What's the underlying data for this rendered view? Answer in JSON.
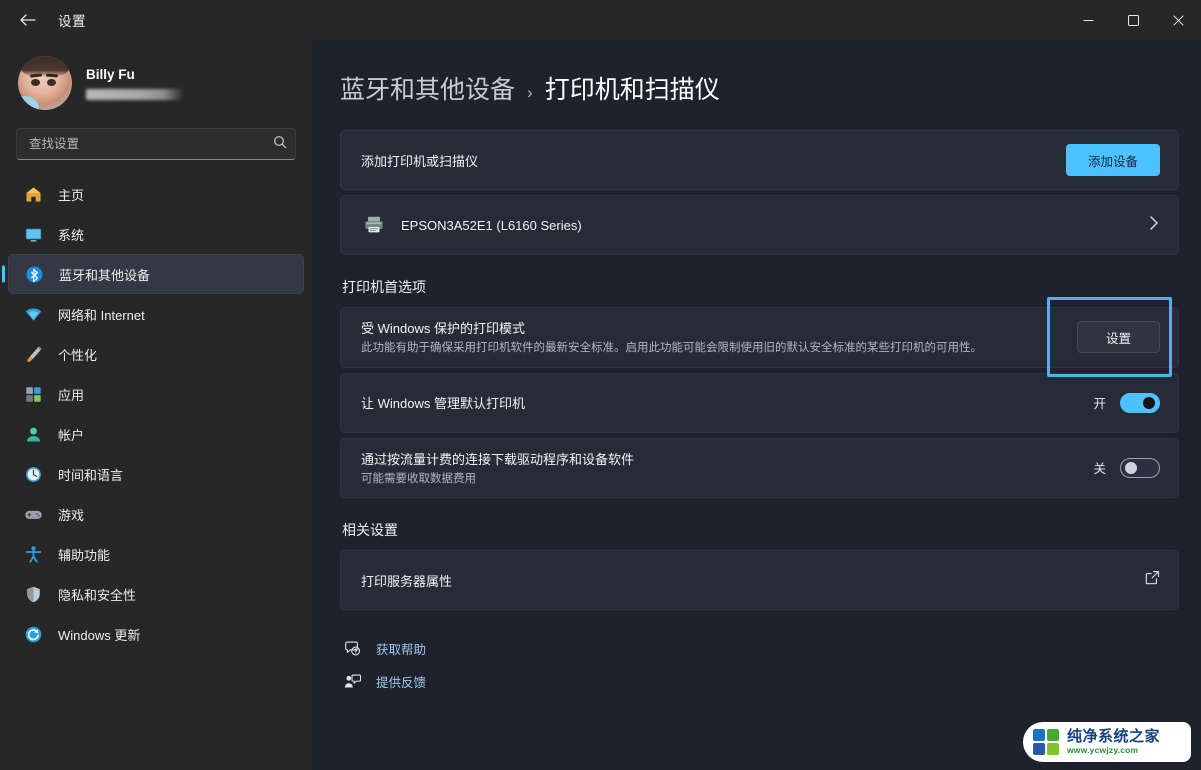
{
  "window": {
    "title": "设置",
    "back_label": "返回",
    "minimize_label": "最小化",
    "maximize_label": "最大化",
    "close_label": "关闭"
  },
  "profile": {
    "name": "Billy Fu",
    "email_redacted": ""
  },
  "search": {
    "placeholder": "查找设置",
    "value": ""
  },
  "sidebar": {
    "items": [
      {
        "label": "主页",
        "icon": "home-icon",
        "active": false
      },
      {
        "label": "系统",
        "icon": "system-icon",
        "active": false
      },
      {
        "label": "蓝牙和其他设备",
        "icon": "bluetooth-icon",
        "active": true
      },
      {
        "label": "网络和 Internet",
        "icon": "network-icon",
        "active": false
      },
      {
        "label": "个性化",
        "icon": "personalization-icon",
        "active": false
      },
      {
        "label": "应用",
        "icon": "apps-icon",
        "active": false
      },
      {
        "label": "帐户",
        "icon": "accounts-icon",
        "active": false
      },
      {
        "label": "时间和语言",
        "icon": "clock-icon",
        "active": false
      },
      {
        "label": "游戏",
        "icon": "gaming-icon",
        "active": false
      },
      {
        "label": "辅助功能",
        "icon": "accessibility-icon",
        "active": false
      },
      {
        "label": "隐私和安全性",
        "icon": "shield-icon",
        "active": false
      },
      {
        "label": "Windows 更新",
        "icon": "update-icon",
        "active": false
      }
    ]
  },
  "breadcrumb": {
    "parent": "蓝牙和其他设备",
    "separator": "›",
    "current": "打印机和扫描仪"
  },
  "main": {
    "add_printer": {
      "title": "添加打印机或扫描仪",
      "button": "添加设备"
    },
    "printer": {
      "name": "EPSON3A52E1 (L6160 Series)",
      "icon": "printer-icon",
      "chevron": "chevron-right-icon"
    },
    "preferences_heading": "打印机首选项",
    "protected_print": {
      "title": "受 Windows 保护的打印模式",
      "description": "此功能有助于确保采用打印机软件的最新安全标准。启用此功能可能会限制使用旧的默认安全标准的某些打印机的可用性。",
      "button": "设置",
      "highlighted": true,
      "highlight_color": "#47b6f0"
    },
    "default_printer": {
      "title": "让 Windows 管理默认打印机",
      "state_label": "开",
      "state": "on"
    },
    "metered_download": {
      "title": "通过按流量计费的连接下载驱动程序和设备软件",
      "subtitle": "可能需要收取数据费用",
      "state_label": "关",
      "state": "off"
    },
    "related_heading": "相关设置",
    "print_server": {
      "title": "打印服务器属性",
      "icon": "external-link-icon"
    },
    "footer": [
      {
        "label": "获取帮助",
        "icon": "help-icon"
      },
      {
        "label": "提供反馈",
        "icon": "feedback-icon"
      }
    ]
  },
  "watermark": {
    "title": "纯净系统之家",
    "url": "www.ycwjzy.com"
  },
  "colors": {
    "accent": "#4cc2ff",
    "highlight": "#47b6f0",
    "card_bg": "#262b38",
    "sidebar_bg": "#272727",
    "content_bg": "#1e222c",
    "link": "#9ecaf2"
  }
}
